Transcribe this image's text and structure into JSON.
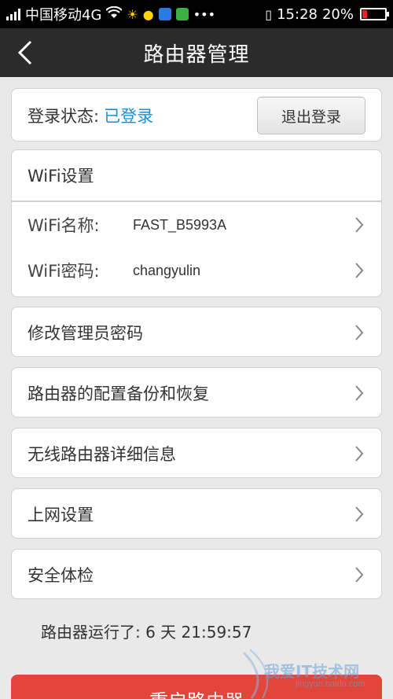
{
  "status_bar": {
    "carrier": "中国移动4G",
    "time": "15:28",
    "battery": "20%",
    "battery_level": 0.2,
    "icons": [
      "signal-icon",
      "wifi-icon",
      "sun-icon",
      "emoji-icon",
      "app-icon",
      "wechat-icon",
      "more-icon",
      "vibrate-icon",
      "battery-icon"
    ]
  },
  "header": {
    "title": "路由器管理",
    "back_icon": "chevron-left-icon"
  },
  "login": {
    "label": "登录状态:",
    "status": "已登录",
    "status_color": "#1a8fd6",
    "logout_label": "退出登录"
  },
  "wifi": {
    "header": "WiFi设置",
    "rows": [
      {
        "label": "WiFi名称:",
        "value": "FAST_B5993A"
      },
      {
        "label": "WiFi密码:",
        "value": "changyulin"
      }
    ]
  },
  "menu": [
    {
      "label": "修改管理员密码"
    },
    {
      "label": "路由器的配置备份和恢复"
    },
    {
      "label": "无线路由器详细信息"
    },
    {
      "label": "上网设置"
    },
    {
      "label": "安全体检"
    }
  ],
  "uptime": "路由器运行了:  6 天 21:59:57",
  "reboot_label": "重启路由器",
  "watermark": {
    "text": "我爱IT技术网",
    "sub": "jingyan.baidu.com"
  },
  "colors": {
    "accent": "#1a8fd6",
    "reboot": "#e2463a",
    "title_bar": "#2b2b2b"
  }
}
